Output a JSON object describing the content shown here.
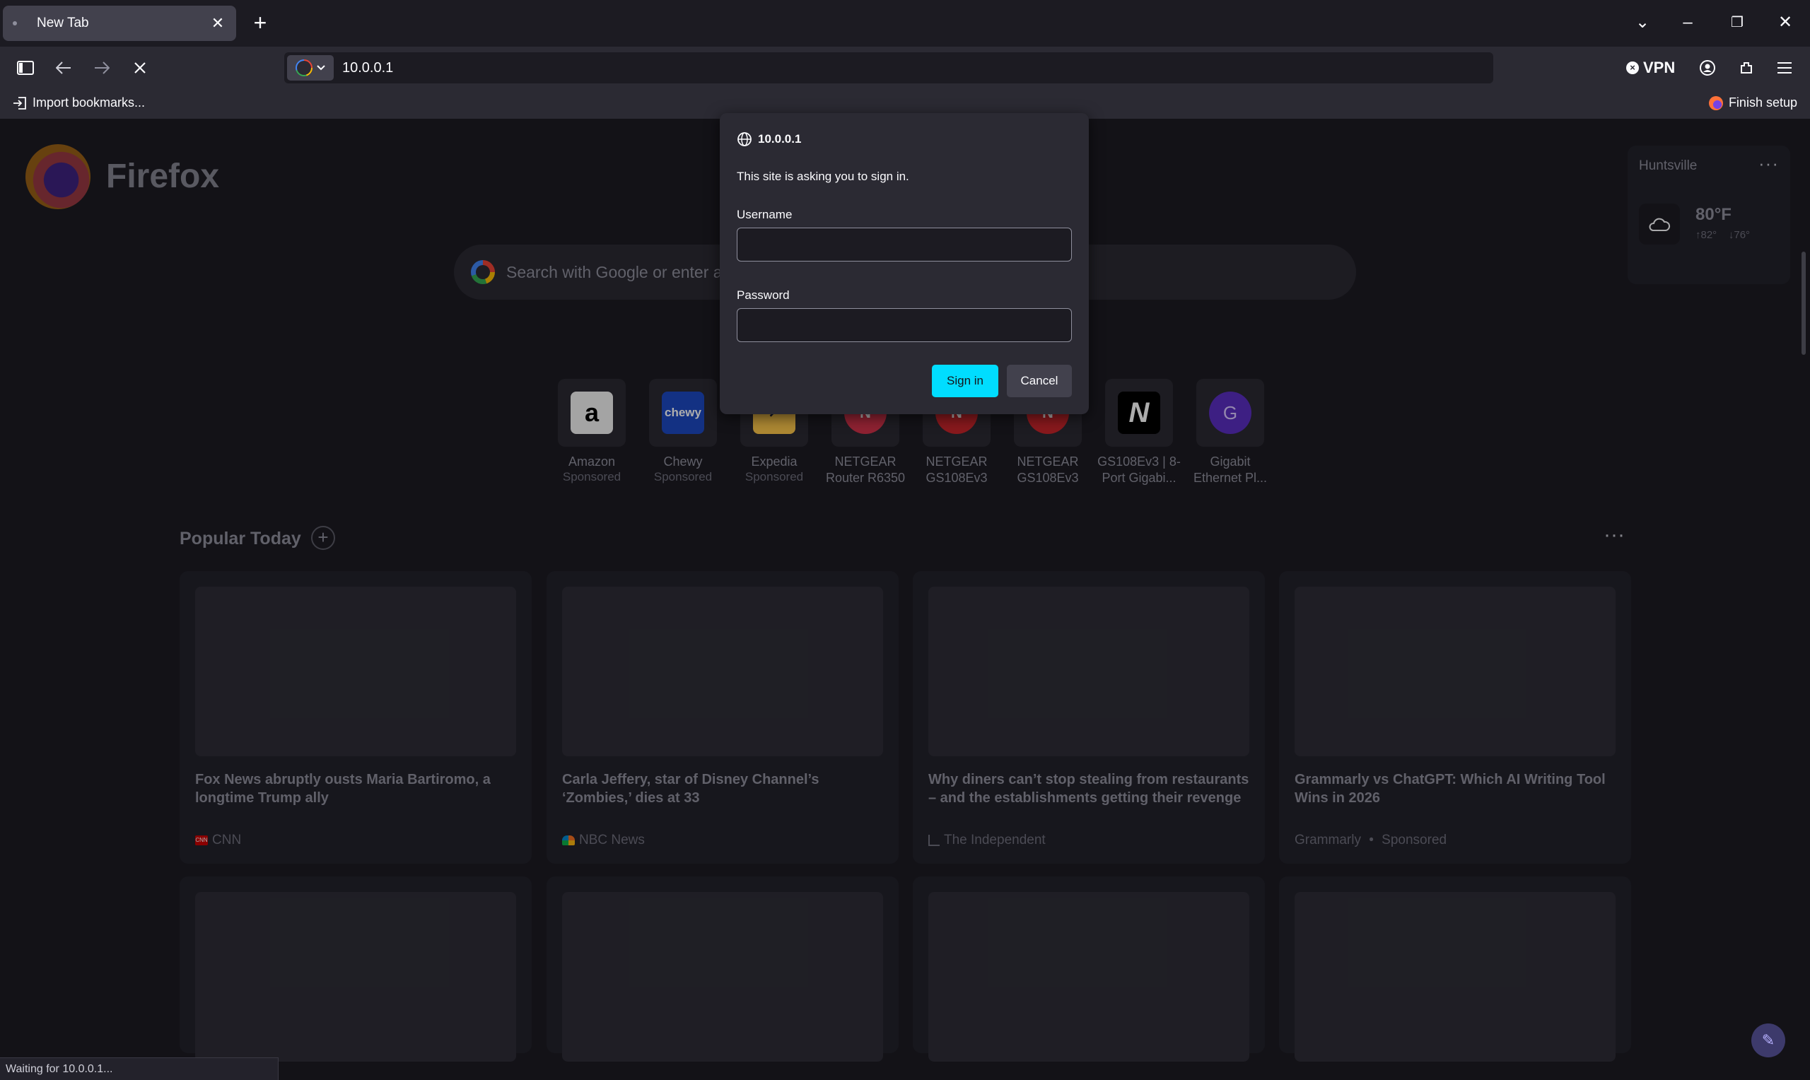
{
  "tab": {
    "title": "New Tab",
    "close": "✕"
  },
  "window": {
    "new_tab": "+",
    "list_all_tabs": "⌄",
    "minimize": "–",
    "restore": "❐",
    "close": "✕"
  },
  "toolbar": {
    "url": "10.0.0.1",
    "vpn_label": "VPN"
  },
  "bookmarks": {
    "import_label": "Import bookmarks...",
    "finish_setup_label": "Finish setup"
  },
  "newtab": {
    "brand": "Firefox",
    "search_placeholder": "Search with Google or enter address",
    "weather": {
      "city": "Huntsville",
      "temp": "80°F",
      "high": "↑82°",
      "low": "↓76°",
      "more": "···"
    },
    "top_sites": [
      {
        "label": "Amazon",
        "sub": "Sponsored",
        "icon": "amazon-icon",
        "glyph": "a",
        "bg": "#f2f2f2",
        "fg": "#000000"
      },
      {
        "label": "Chewy",
        "sub": "Sponsored",
        "icon": "chewy-icon",
        "glyph": "chewy",
        "bg": "#1c49c2",
        "fg": "#ffffff"
      },
      {
        "label": "Expedia",
        "sub": "Sponsored",
        "icon": "expedia-icon",
        "glyph": "↗",
        "bg": "#ffc94c",
        "fg": "#191e3b"
      },
      {
        "label": "NETGEAR",
        "sub": "Router R6350",
        "icon": "netgear-letter-icon",
        "glyph": "N",
        "bg": "#d2334a",
        "fg": "#ffffff"
      },
      {
        "label": "NETGEAR",
        "sub": "GS108Ev3",
        "icon": "netgear-letter-icon",
        "glyph": "N",
        "bg": "#c9252c",
        "fg": "#ffffff"
      },
      {
        "label": "NETGEAR",
        "sub": "GS108Ev3",
        "icon": "netgear-letter-icon",
        "glyph": "N",
        "bg": "#c9252c",
        "fg": "#ffffff"
      },
      {
        "label": "GS108Ev3 | 8-",
        "sub": "Port Gigabi...",
        "icon": "netgear-logo-icon",
        "glyph": "N",
        "bg": "#000000",
        "fg": "#ffffff"
      },
      {
        "label": "Gigabit",
        "sub": "Ethernet Pl...",
        "icon": "letter-g-icon",
        "glyph": "G",
        "bg": "#5b2ec2",
        "fg": "#d9c8ff"
      }
    ],
    "popular": {
      "title": "Popular Today",
      "cards": [
        {
          "title": "Fox News abruptly ousts Maria Bartiromo, a longtime Trump ally",
          "source": "CNN",
          "sponsored": ""
        },
        {
          "title": "Carla Jeffery, star of Disney Channel’s ‘Zombies,’ dies at 33",
          "source": "NBC News",
          "sponsored": ""
        },
        {
          "title": "Why diners can’t stop stealing from restaurants – and the establishments getting their revenge",
          "source": "The Independent",
          "sponsored": ""
        },
        {
          "title": "Grammarly vs ChatGPT: Which AI Writing Tool Wins in 2026",
          "source": "Grammarly",
          "sponsored": "Sponsored"
        }
      ]
    }
  },
  "dialog": {
    "host": "10.0.0.1",
    "message": "This site is asking you to sign in.",
    "username_label": "Username",
    "username_value": "",
    "password_label": "Password",
    "password_value": "",
    "signin_label": "Sign in",
    "cancel_label": "Cancel",
    "accent": "#00ddff"
  },
  "status": {
    "text": "Waiting for 10.0.0.1..."
  }
}
